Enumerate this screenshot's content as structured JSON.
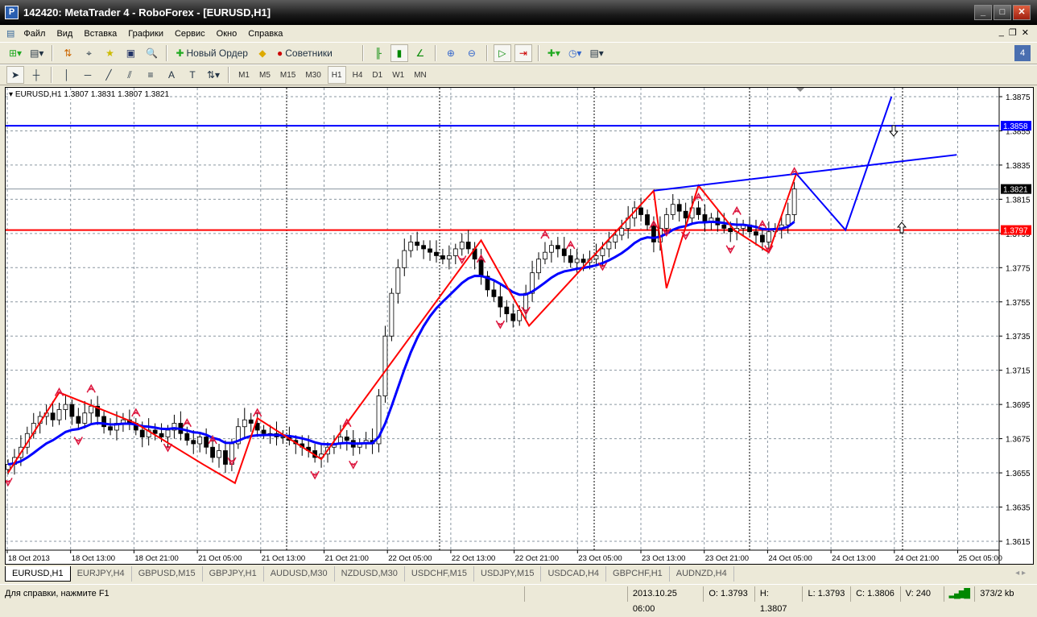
{
  "window": {
    "title": "142420: MetaTrader 4 - RoboForex - [EURUSD,H1]"
  },
  "menu": [
    "Файл",
    "Вид",
    "Вставка",
    "Графики",
    "Сервис",
    "Окно",
    "Справка"
  ],
  "toolbar": {
    "new_order": "Новый Ордер",
    "experts": "Советники"
  },
  "timeframes": [
    "M1",
    "M5",
    "M15",
    "M30",
    "H1",
    "H4",
    "D1",
    "W1",
    "MN"
  ],
  "active_timeframe": "H1",
  "chart_data": {
    "type": "candlestick",
    "symbol_info": "EURUSD,H1  1.3807 1.3831 1.3807 1.3821",
    "ylim": [
      1.3608,
      1.388
    ],
    "y_ticks": [
      "1.3875",
      "1.3855",
      "1.3835",
      "1.3815",
      "1.3795",
      "1.3775",
      "1.3755",
      "1.3735",
      "1.3715",
      "1.3695",
      "1.3675",
      "1.3655",
      "1.3635",
      "1.3615"
    ],
    "x_labels": [
      "18 Oct 2013",
      "18 Oct 13:00",
      "18 Oct 21:00",
      "21 Oct 05:00",
      "21 Oct 13:00",
      "21 Oct 21:00",
      "22 Oct 05:00",
      "22 Oct 13:00",
      "22 Oct 21:00",
      "23 Oct 05:00",
      "23 Oct 13:00",
      "23 Oct 21:00",
      "24 Oct 05:00",
      "24 Oct 13:00",
      "24 Oct 21:00",
      "25 Oct 05:00"
    ],
    "closes": [
      1.366,
      1.3664,
      1.367,
      1.3678,
      1.3684,
      1.3688,
      1.369,
      1.3686,
      1.3692,
      1.3695,
      1.3688,
      1.3684,
      1.369,
      1.3694,
      1.3688,
      1.3682,
      1.368,
      1.3684,
      1.3686,
      1.3684,
      1.368,
      1.3676,
      1.368,
      1.3678,
      1.3676,
      1.368,
      1.3684,
      1.3678,
      1.3674,
      1.3672,
      1.3676,
      1.367,
      1.3664,
      1.3668,
      1.366,
      1.3672,
      1.3682,
      1.3686,
      1.3684,
      1.368,
      1.3678,
      1.3678,
      1.3676,
      1.3676,
      1.3674,
      1.3672,
      1.367,
      1.3668,
      1.3664,
      1.3666,
      1.367,
      1.3672,
      1.3676,
      1.3674,
      1.367,
      1.3672,
      1.3674,
      1.3672,
      1.37,
      1.3735,
      1.376,
      1.3775,
      1.3785,
      1.379,
      1.3788,
      1.3786,
      1.3784,
      1.3782,
      1.378,
      1.3782,
      1.3786,
      1.379,
      1.3786,
      1.378,
      1.377,
      1.3762,
      1.3758,
      1.3752,
      1.3748,
      1.3744,
      1.375,
      1.376,
      1.3772,
      1.378,
      1.3784,
      1.3788,
      1.3786,
      1.3782,
      1.3778,
      1.378,
      1.3778,
      1.378,
      1.3782,
      1.3786,
      1.379,
      1.3794,
      1.3798,
      1.3804,
      1.381,
      1.3806,
      1.38,
      1.379,
      1.3798,
      1.3806,
      1.3812,
      1.3808,
      1.3804,
      1.381,
      1.3806,
      1.3802,
      1.3804,
      1.38,
      1.3798,
      1.3796,
      1.3798,
      1.38,
      1.3796,
      1.3794,
      1.379,
      1.3796,
      1.3798,
      1.38,
      1.3806,
      1.3821
    ],
    "zigzag": [
      [
        0,
        1.3655
      ],
      [
        8,
        1.3702
      ],
      [
        20,
        1.3684
      ],
      [
        30.5,
        1.366
      ],
      [
        35.5,
        1.3649
      ],
      [
        39,
        1.3687
      ],
      [
        49,
        1.3663
      ],
      [
        53,
        1.3684
      ],
      [
        74,
        1.3791
      ],
      [
        81.5,
        1.3741
      ],
      [
        101,
        1.382
      ],
      [
        103,
        1.3763
      ],
      [
        108,
        1.3823
      ],
      [
        113.6,
        1.3797
      ],
      [
        119,
        1.3784
      ],
      [
        123.3,
        1.383
      ]
    ],
    "trendline_upper": [
      [
        101,
        1.382
      ],
      [
        148.4,
        1.3841
      ]
    ],
    "projection": [
      [
        123.3,
        1.383
      ],
      [
        131,
        1.3797
      ],
      [
        138.2,
        1.3875
      ]
    ],
    "fractals_up": [
      8,
      13,
      20,
      28,
      32,
      39,
      53,
      74,
      84,
      88,
      101,
      108,
      114,
      118,
      123
    ],
    "fractals_down": [
      0,
      11,
      25,
      35,
      48,
      54,
      71,
      77,
      81,
      93,
      103,
      106,
      113,
      119
    ],
    "hlines": {
      "blue": "1.3858",
      "current": "1.3821",
      "red": "1.3797"
    },
    "colors": {
      "zigzag": "#ff0000",
      "ma": "#0000ff",
      "fractal": "#dc143c",
      "bid_line": "#000000"
    }
  },
  "tabs": [
    "EURUSD,H1",
    "EURJPY,H4",
    "GBPUSD,M15",
    "GBPJPY,H1",
    "AUDUSD,M30",
    "NZDUSD,M30",
    "USDCHF,M15",
    "USDJPY,M15",
    "USDCAD,H4",
    "GBPCHF,H1",
    "AUDNZD,H4"
  ],
  "status": {
    "help": "Для справки, нажмите F1",
    "datetime": "2013.10.25 06:00",
    "open": "O: 1.3793",
    "high": "H: 1.3807",
    "low": "L: 1.3793",
    "close": "C: 1.3806",
    "volume": "V: 240",
    "traffic": "373/2 kb"
  }
}
